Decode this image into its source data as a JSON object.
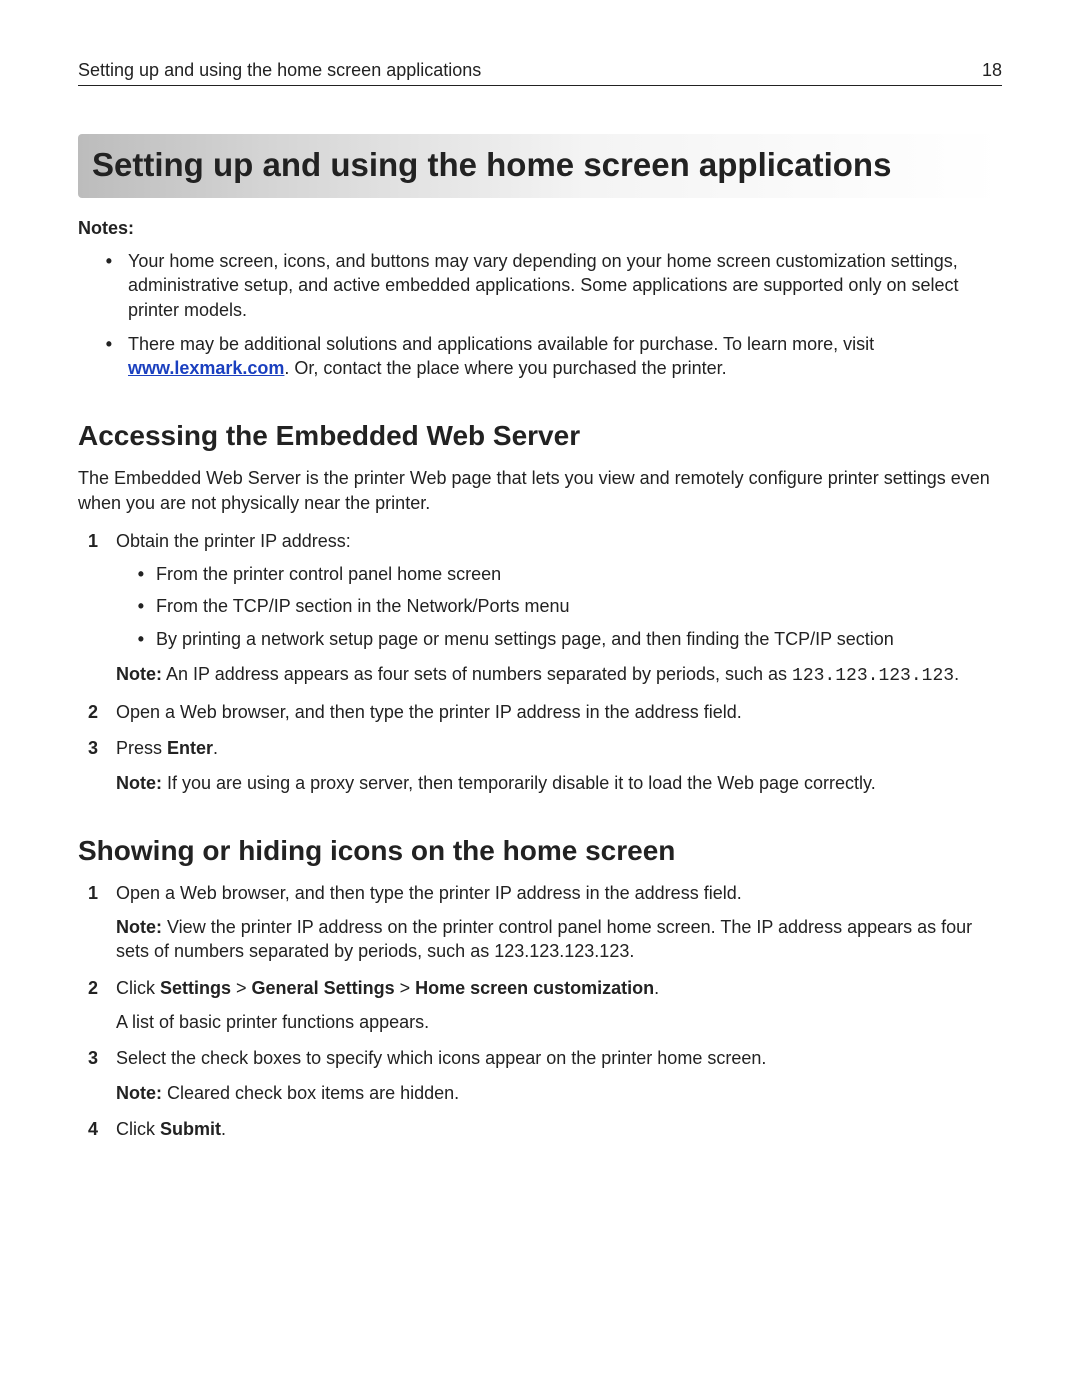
{
  "header": {
    "running_title": "Setting up and using the home screen applications",
    "page_number": "18"
  },
  "chapter_title": "Setting up and using the home screen applications",
  "notes": {
    "label": "Notes:",
    "items": [
      "Your home screen, icons, and buttons may vary depending on your home screen customization settings, administrative setup, and active embedded applications. Some applications are supported only on select printer models."
    ],
    "item2": {
      "pre": "There may be additional solutions and applications available for purchase. To learn more, visit ",
      "link": "www.lexmark.com",
      "post": ". Or, contact the place where you purchased the printer."
    }
  },
  "section_a": {
    "heading": "Accessing the Embedded Web Server",
    "intro": "The Embedded Web Server is the printer Web page that lets you view and remotely configure printer settings even when you are not physically near the printer.",
    "step1": {
      "text": "Obtain the printer IP address:",
      "bullets": [
        "From the printer control panel home screen",
        "From the TCP/IP section in the Network/Ports menu",
        "By printing a network setup page or menu settings page, and then finding the TCP/IP section"
      ],
      "note_label": "Note:",
      "note_text": " An IP address appears as four sets of numbers separated by periods, such as ",
      "note_code": "123.123.123.123",
      "note_post": "."
    },
    "step2": "Open a Web browser, and then type the printer IP address in the address field.",
    "step3": {
      "pre": "Press ",
      "bold": "Enter",
      "post": ".",
      "note_label": "Note:",
      "note_text": " If you are using a proxy server, then temporarily disable it to load the Web page correctly."
    }
  },
  "section_b": {
    "heading": "Showing or hiding icons on the home screen",
    "step1": {
      "text": "Open a Web browser, and then type the printer IP address in the address field.",
      "note_label": "Note:",
      "note_text": " View the printer IP address on the printer control panel home screen. The IP address appears as four sets of numbers separated by periods, such as 123.123.123.123."
    },
    "step2": {
      "pre": "Click ",
      "b1": "Settings",
      "s1": " > ",
      "b2": "General Settings",
      "s2": " > ",
      "b3": "Home screen customization",
      "post": ".",
      "after": "A list of basic printer functions appears."
    },
    "step3": {
      "text": "Select the check boxes to specify which icons appear on the printer home screen.",
      "note_label": "Note:",
      "note_text": " Cleared check box items are hidden."
    },
    "step4": {
      "pre": "Click ",
      "bold": "Submit",
      "post": "."
    }
  }
}
